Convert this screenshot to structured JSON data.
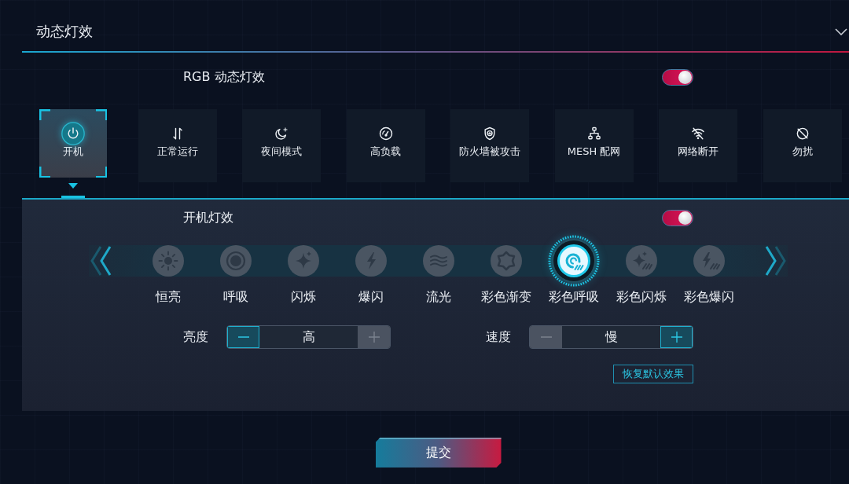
{
  "section": {
    "title": "动态灯效"
  },
  "rgb_toggle": {
    "label": "RGB 动态灯效",
    "on": true
  },
  "modes": [
    {
      "label": "开机",
      "selected": true
    },
    {
      "label": "正常运行",
      "selected": false
    },
    {
      "label": "夜间模式",
      "selected": false
    },
    {
      "label": "高负载",
      "selected": false
    },
    {
      "label": "防火墙被攻击",
      "selected": false
    },
    {
      "label": "MESH 配网",
      "selected": false
    },
    {
      "label": "网络断开",
      "selected": false
    },
    {
      "label": "勿扰",
      "selected": false
    }
  ],
  "mode_panel": {
    "toggle": {
      "label": "开机灯效",
      "on": true
    },
    "effects": [
      {
        "label": "恒亮",
        "selected": false
      },
      {
        "label": "呼吸",
        "selected": false
      },
      {
        "label": "闪烁",
        "selected": false
      },
      {
        "label": "爆闪",
        "selected": false
      },
      {
        "label": "流光",
        "selected": false
      },
      {
        "label": "彩色渐变",
        "selected": false
      },
      {
        "label": "彩色呼吸",
        "selected": true
      },
      {
        "label": "彩色闪烁",
        "selected": false
      },
      {
        "label": "彩色爆闪",
        "selected": false
      }
    ],
    "brightness": {
      "label": "亮度",
      "value": "高",
      "decrease": {
        "disabled": false
      },
      "increase": {
        "disabled": true
      }
    },
    "speed": {
      "label": "速度",
      "value": "慢",
      "decrease": {
        "disabled": true
      },
      "increase": {
        "disabled": false
      }
    },
    "restore_button": "恢复默认效果"
  },
  "submit_button": "提交"
}
